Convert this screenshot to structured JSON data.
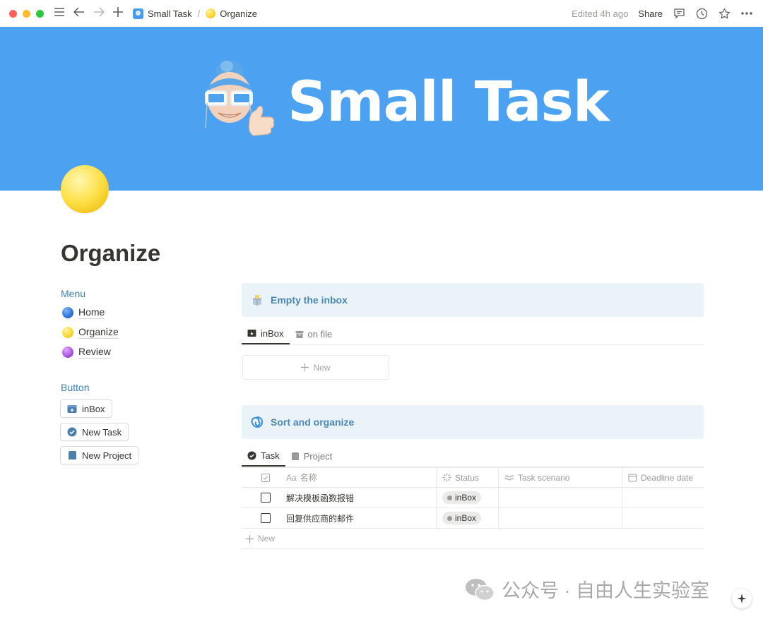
{
  "window": {
    "traffic_colors": [
      "#ff5f57",
      "#febc2e",
      "#28c840"
    ]
  },
  "topbar": {
    "breadcrumb": [
      {
        "label": "Small Task",
        "icon": "memoji-favicon"
      },
      {
        "label": "Organize",
        "icon": "yellow-circle"
      }
    ],
    "edited": "Edited 4h ago",
    "share": "Share"
  },
  "cover": {
    "title": "Small Task",
    "background": "#4ca2f1"
  },
  "page": {
    "title": "Organize",
    "icon": "yellow-circle"
  },
  "left": {
    "menu_heading": "Menu",
    "menu": [
      {
        "label": "Home",
        "icon": "blue-circle"
      },
      {
        "label": "Organize",
        "icon": "yellow-circle"
      },
      {
        "label": "Review",
        "icon": "purple-circle"
      }
    ],
    "button_heading": "Button",
    "buttons": [
      {
        "label": "inBox",
        "icon": "inbox-tray-icon"
      },
      {
        "label": "New Task",
        "icon": "check-circle-icon"
      },
      {
        "label": "New Project",
        "icon": "archive-icon"
      }
    ]
  },
  "inbox_section": {
    "title": "Empty the inbox",
    "tabs": [
      {
        "label": "inBox",
        "active": true
      },
      {
        "label": "on file",
        "active": false
      }
    ],
    "new_label": "New"
  },
  "sort_section": {
    "title": "Sort and organize",
    "tabs": [
      {
        "label": "Task",
        "active": true
      },
      {
        "label": "Project",
        "active": false
      }
    ],
    "columns": {
      "name_prefix": "Aa",
      "name": "名称",
      "status": "Status",
      "scenario": "Task scenario",
      "deadline": "Deadline date"
    },
    "rows": [
      {
        "name": "解决模板函数报错",
        "status": "inBox",
        "checked": false
      },
      {
        "name": "回复供应商的邮件",
        "status": "inBox",
        "checked": false
      }
    ],
    "new_label": "New"
  },
  "watermark": {
    "text": "公众号 · 自由人生实验室"
  },
  "accent_color": "#4d87b3"
}
